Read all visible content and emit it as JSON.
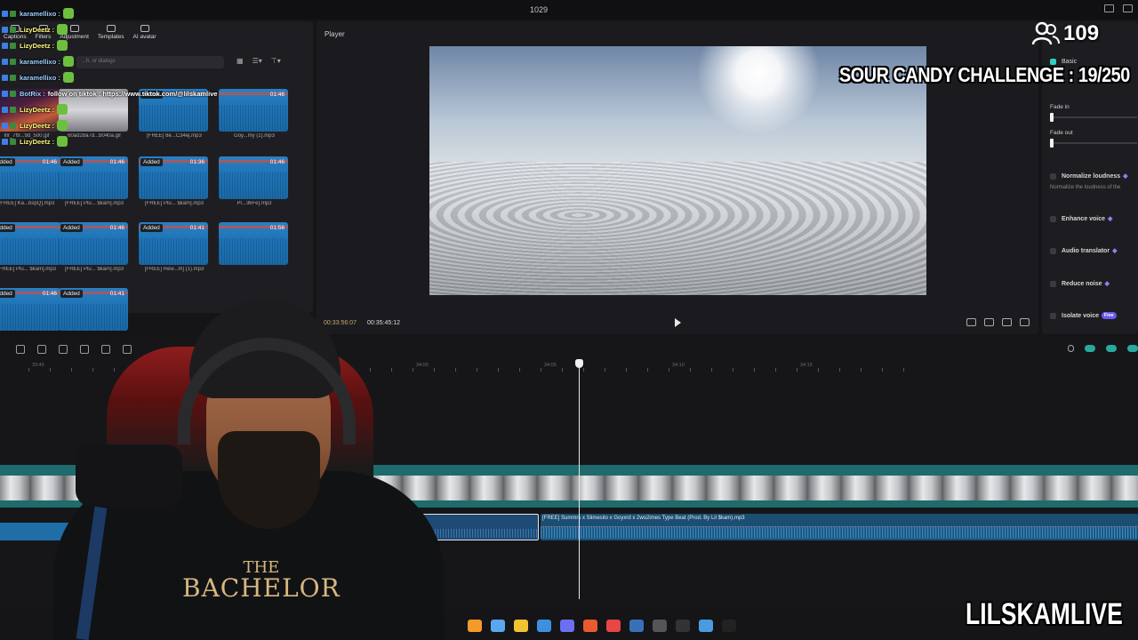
{
  "window": {
    "title": "1029"
  },
  "toolbar": {
    "tools": [
      {
        "label": "Captions"
      },
      {
        "label": "Filters"
      },
      {
        "label": "Adjustment"
      },
      {
        "label": "Templates"
      },
      {
        "label": "AI avatar"
      }
    ],
    "search_placeholder": "...h, or dialogs"
  },
  "media": {
    "tiles": [
      {
        "badge": "",
        "duration": "",
        "name": "Illr_7f9...9d_500.gif",
        "kind": "img1"
      },
      {
        "badge": "",
        "duration": "",
        "name": "60ad28a7d...b040a.gif",
        "kind": "img2"
      },
      {
        "badge": "Added",
        "duration": "01:46",
        "name": "[FREE] 8e...C34ej.mp3",
        "kind": "audio"
      },
      {
        "badge": "",
        "duration": "01:46",
        "name": "Goy...my (1).mp3",
        "kind": "audio"
      },
      {
        "badge": "Added",
        "duration": "01:46",
        "name": "[FREE] Ka...bspQ].mp3",
        "kind": "audio"
      },
      {
        "badge": "Added",
        "duration": "01:46",
        "name": "[FREE] Plu... $kam].mp3",
        "kind": "audio"
      },
      {
        "badge": "Added",
        "duration": "01:36",
        "name": "[FREE] Plu... $kam].mp3",
        "kind": "audio"
      },
      {
        "badge": "",
        "duration": "01:46",
        "name": "Pl...36Fe].mp3",
        "kind": "audio"
      },
      {
        "badge": "Added",
        "duration": "",
        "name": "[FREE] Plu... $kam].mp3",
        "kind": "audio"
      },
      {
        "badge": "Added",
        "duration": "01:46",
        "name": "[FREE] Plu... $kam].mp3",
        "kind": "audio"
      },
      {
        "badge": "Added",
        "duration": "01:41",
        "name": "[FREE] Rew...m] (1).mp3",
        "kind": "audio"
      },
      {
        "badge": "",
        "duration": "01:56",
        "name": "",
        "kind": "audio"
      },
      {
        "badge": "Added",
        "duration": "01:46",
        "name": "",
        "kind": "audio"
      },
      {
        "badge": "Added",
        "duration": "01:41",
        "name": "",
        "kind": "audio"
      }
    ]
  },
  "chat": [
    {
      "user": "karamellixo :",
      "text": "",
      "liz": false,
      "emote": true
    },
    {
      "user": "LizyDeetz :",
      "text": "",
      "liz": true,
      "emote": true
    },
    {
      "user": "LizyDeetz :",
      "text": "",
      "liz": true,
      "emote": true
    },
    {
      "user": "karamellixo :",
      "text": "",
      "liz": false,
      "emote": true
    },
    {
      "user": "karamellixo :",
      "text": "",
      "liz": false,
      "emote": true
    },
    {
      "user": "BotRix :",
      "text": "follow on tiktok : https://www.tiktok.com/@lilskamlive",
      "liz": false,
      "emote": false
    },
    {
      "user": "LizyDeetz :",
      "text": "",
      "liz": true,
      "emote": true
    },
    {
      "user": "LizyDeetz :",
      "text": "",
      "liz": true,
      "emote": true
    },
    {
      "user": "LizyDeetz :",
      "text": "",
      "liz": true,
      "emote": true
    }
  ],
  "player": {
    "label": "Player",
    "timecode_current": "00:33:56:07",
    "timecode_total": "00:35:45:12"
  },
  "right_panel": {
    "changer_label": "changer",
    "basic_label": "Basic",
    "fade_in": "Fade in",
    "fade_out": "Fade out",
    "normalize": "Normalize loudness",
    "normalize_desc": "Normalize the loudness of the",
    "enhance": "Enhance voice",
    "translator": "Audio translator",
    "reduce": "Reduce noise",
    "isolate": "Isolate voice",
    "free_tag": "Free"
  },
  "timeline": {
    "ticks": [
      "33:45",
      "33:50",
      "33:55",
      "34:00",
      "34:05",
      "34:10",
      "34:15"
    ],
    "audio_clip_label": "[FREE] Summrs x Slimesito x Goyxrd x 2wo2imes Type Beat (Prod. By Lil $kam).mp3"
  },
  "stream": {
    "viewers": "109",
    "challenge": "SOUR CANDY CHALLENGE : 19/250",
    "brand": "LILSKAMLIVE",
    "shirt_line1": "THE",
    "shirt_line2": "BACHELOR"
  },
  "taskbar": {
    "apps": [
      "fl-studio-icon",
      "copilot-icon",
      "folder-icon",
      "store-icon",
      "discord-icon",
      "brave-icon",
      "chrome-icon",
      "steam-icon",
      "app-icon",
      "4k-icon",
      "notepad-icon",
      "capcut-icon"
    ],
    "colors": [
      "#f29b2a",
      "#5aa7f0",
      "#f2c230",
      "#3d8fe0",
      "#6b6ff2",
      "#e85b2e",
      "#e84545",
      "#3a70b8",
      "#555555",
      "#333333",
      "#4a9be0",
      "#222222"
    ]
  }
}
